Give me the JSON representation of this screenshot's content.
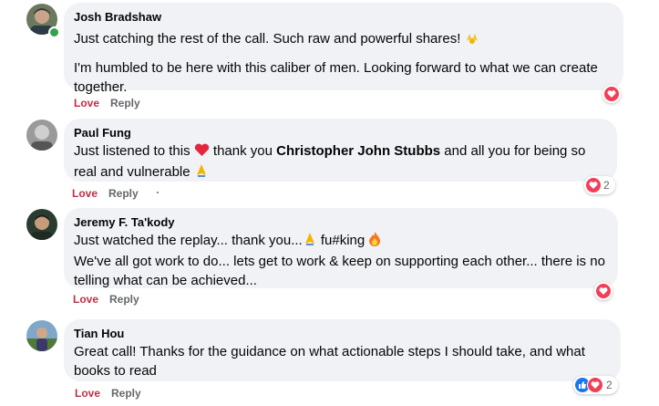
{
  "comments": [
    {
      "author": "Josh Bradshaw",
      "line1": "Just catching the rest of the call. Such raw and powerful shares! ",
      "line1_emoji": "raising-hands-emoji",
      "para2": "I'm humbled to be here with this caliber of men. Looking forward to what we can create together.",
      "love_label": "Love",
      "reply_label": "Reply",
      "reactions": [
        "love"
      ],
      "online": true
    },
    {
      "author": "Paul Fung",
      "text_a": "Just listened to this ",
      "text_b": " thank you ",
      "mention": "Christopher John Stubbs",
      "text_c": " and all you for being so real and vulnerable ",
      "love_label": "Love",
      "reply_label": "Reply",
      "reactions": [
        "love"
      ],
      "reaction_count": "2"
    },
    {
      "author": "Jeremy F. Ta'kody",
      "text_a": "Just watched the replay... thank you...",
      "text_b": " fu#king ",
      "para2": "We've all got work to do... lets get to work & keep on supporting each other... there is no telling what can be achieved...",
      "love_label": "Love",
      "reply_label": "Reply",
      "reactions": [
        "love"
      ]
    },
    {
      "author": "Tian Hou",
      "text": "Great call! Thanks for the guidance on what actionable steps I should take, and what books to read",
      "love_label": "Love",
      "reply_label": "Reply",
      "reactions": [
        "like",
        "love"
      ],
      "reaction_count": "2"
    }
  ],
  "colors": {
    "bubble": "#f0f2f5",
    "love": "#c22e46",
    "like": "#1877f2",
    "heart": "#f33e58",
    "online": "#31a24c"
  }
}
